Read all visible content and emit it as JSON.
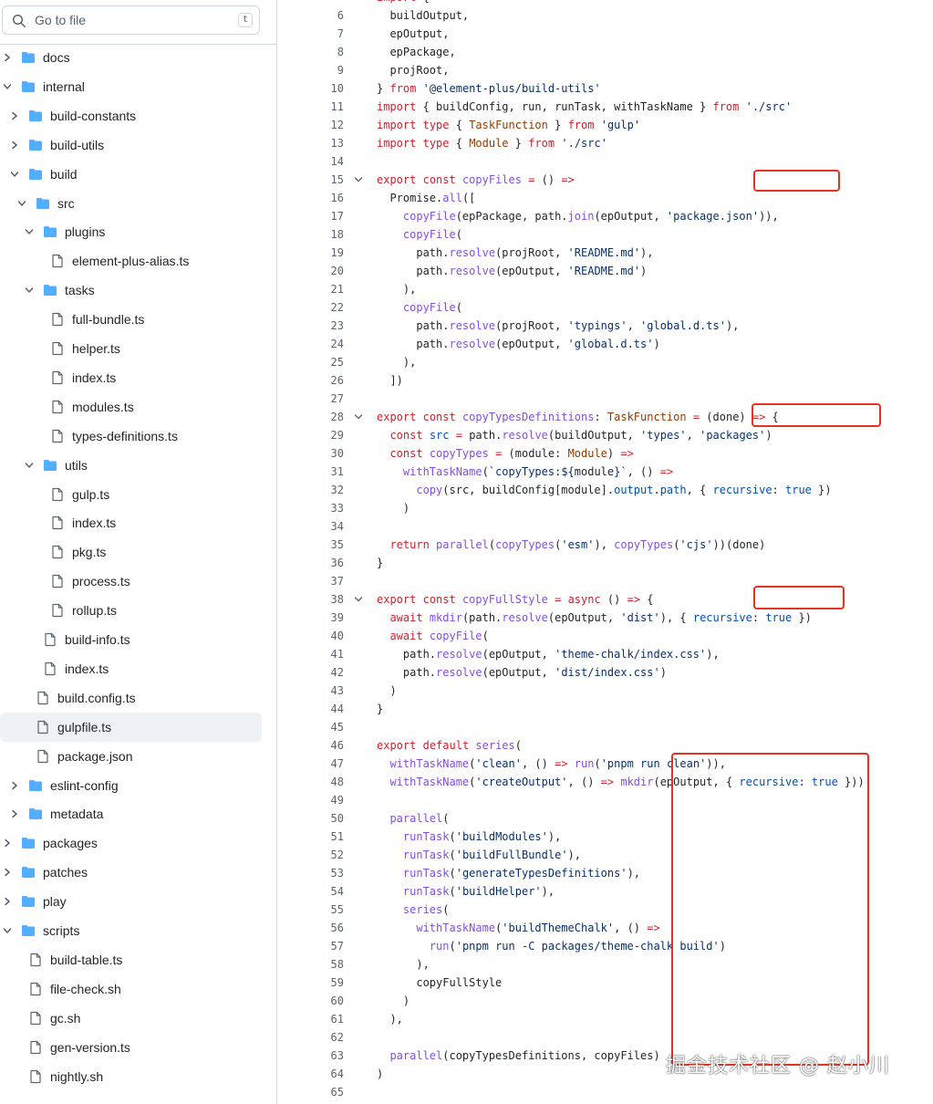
{
  "sidebar": {
    "search": {
      "placeholder": "Go to file",
      "shortcut": "t"
    },
    "tree": [
      {
        "label": "docs",
        "type": "folder",
        "depth": 0,
        "expanded": false
      },
      {
        "label": "internal",
        "type": "folder",
        "depth": 0,
        "expanded": true
      },
      {
        "label": "build-constants",
        "type": "folder",
        "depth": 1,
        "expanded": false
      },
      {
        "label": "build-utils",
        "type": "folder",
        "depth": 1,
        "expanded": false
      },
      {
        "label": "build",
        "type": "folder",
        "depth": 1,
        "expanded": true
      },
      {
        "label": "src",
        "type": "folder",
        "depth": 2,
        "expanded": true
      },
      {
        "label": "plugins",
        "type": "folder",
        "depth": 3,
        "expanded": true
      },
      {
        "label": "element-plus-alias.ts",
        "type": "file",
        "depth": 4
      },
      {
        "label": "tasks",
        "type": "folder",
        "depth": 3,
        "expanded": true
      },
      {
        "label": "full-bundle.ts",
        "type": "file",
        "depth": 4
      },
      {
        "label": "helper.ts",
        "type": "file",
        "depth": 4
      },
      {
        "label": "index.ts",
        "type": "file",
        "depth": 4
      },
      {
        "label": "modules.ts",
        "type": "file",
        "depth": 4
      },
      {
        "label": "types-definitions.ts",
        "type": "file",
        "depth": 4
      },
      {
        "label": "utils",
        "type": "folder",
        "depth": 3,
        "expanded": true
      },
      {
        "label": "gulp.ts",
        "type": "file",
        "depth": 4
      },
      {
        "label": "index.ts",
        "type": "file",
        "depth": 4
      },
      {
        "label": "pkg.ts",
        "type": "file",
        "depth": 4
      },
      {
        "label": "process.ts",
        "type": "file",
        "depth": 4
      },
      {
        "label": "rollup.ts",
        "type": "file",
        "depth": 4
      },
      {
        "label": "build-info.ts",
        "type": "file",
        "depth": 3
      },
      {
        "label": "index.ts",
        "type": "file",
        "depth": 3
      },
      {
        "label": "build.config.ts",
        "type": "file",
        "depth": 2
      },
      {
        "label": "gulpfile.ts",
        "type": "file",
        "depth": 2,
        "selected": true
      },
      {
        "label": "package.json",
        "type": "file",
        "depth": 2
      },
      {
        "label": "eslint-config",
        "type": "folder",
        "depth": 1,
        "expanded": false
      },
      {
        "label": "metadata",
        "type": "folder",
        "depth": 1,
        "expanded": false
      },
      {
        "label": "packages",
        "type": "folder",
        "depth": 0,
        "expanded": false
      },
      {
        "label": "patches",
        "type": "folder",
        "depth": 0,
        "expanded": false
      },
      {
        "label": "play",
        "type": "folder",
        "depth": 0,
        "expanded": false
      },
      {
        "label": "scripts",
        "type": "folder",
        "depth": 0,
        "expanded": true
      },
      {
        "label": "build-table.ts",
        "type": "file",
        "depth": 1
      },
      {
        "label": "file-check.sh",
        "type": "file",
        "depth": 1
      },
      {
        "label": "gc.sh",
        "type": "file",
        "depth": 1
      },
      {
        "label": "gen-version.ts",
        "type": "file",
        "depth": 1
      },
      {
        "label": "nightly.sh",
        "type": "file",
        "depth": 1
      }
    ]
  },
  "code": {
    "lines": [
      {
        "n": "",
        "html": "<span class=\"kw\">import</span> {"
      },
      {
        "n": "6",
        "html": "  buildOutput,"
      },
      {
        "n": "7",
        "html": "  epOutput,"
      },
      {
        "n": "8",
        "html": "  epPackage,"
      },
      {
        "n": "9",
        "html": "  projRoot,"
      },
      {
        "n": "10",
        "html": "} <span class=\"kw\">from</span> <span class=\"str\">'@element-plus/build-utils'</span>"
      },
      {
        "n": "11",
        "html": "<span class=\"kw\">import</span> { buildConfig, run, runTask, withTaskName } <span class=\"kw\">from</span> <span class=\"str\">'./src'</span>"
      },
      {
        "n": "12",
        "html": "<span class=\"kw\">import</span> <span class=\"kw\">type</span> { <span class=\"ty\">TaskFunction</span> } <span class=\"kw\">from</span> <span class=\"str\">'gulp'</span>"
      },
      {
        "n": "13",
        "html": "<span class=\"kw\">import</span> <span class=\"kw\">type</span> { <span class=\"ty\">Module</span> } <span class=\"kw\">from</span> <span class=\"str\">'./src'</span>"
      },
      {
        "n": "14",
        "html": ""
      },
      {
        "n": "15",
        "html": "<span class=\"kw\">export</span> <span class=\"kw\">const</span> <span class=\"fn\">copyFiles</span> <span class=\"kw\">=</span> () <span class=\"kw\">=&gt;</span>",
        "fold": true
      },
      {
        "n": "16",
        "html": "  Promise.<span class=\"fn\">all</span>(["
      },
      {
        "n": "17",
        "html": "    <span class=\"fn\">copyFile</span>(epPackage, path.<span class=\"fn\">join</span>(epOutput, <span class=\"str\">'package.json'</span>)),"
      },
      {
        "n": "18",
        "html": "    <span class=\"fn\">copyFile</span>("
      },
      {
        "n": "19",
        "html": "      path.<span class=\"fn\">resolve</span>(projRoot, <span class=\"str\">'README.md'</span>),"
      },
      {
        "n": "20",
        "html": "      path.<span class=\"fn\">resolve</span>(epOutput, <span class=\"str\">'README.md'</span>)"
      },
      {
        "n": "21",
        "html": "    ),"
      },
      {
        "n": "22",
        "html": "    <span class=\"fn\">copyFile</span>("
      },
      {
        "n": "23",
        "html": "      path.<span class=\"fn\">resolve</span>(projRoot, <span class=\"str\">'typings'</span>, <span class=\"str\">'global.d.ts'</span>),"
      },
      {
        "n": "24",
        "html": "      path.<span class=\"fn\">resolve</span>(epOutput, <span class=\"str\">'global.d.ts'</span>)"
      },
      {
        "n": "25",
        "html": "    ),"
      },
      {
        "n": "26",
        "html": "  ])"
      },
      {
        "n": "27",
        "html": ""
      },
      {
        "n": "28",
        "html": "<span class=\"kw\">export</span> <span class=\"kw\">const</span> <span class=\"fn\">copyTypesDefinitions</span>: <span class=\"ty\">TaskFunction</span> <span class=\"kw\">=</span> (done) <span class=\"kw\">=&gt;</span> {",
        "fold": true
      },
      {
        "n": "29",
        "html": "  <span class=\"kw\">const</span> <span class=\"con\">src</span> <span class=\"kw\">=</span> path.<span class=\"fn\">resolve</span>(buildOutput, <span class=\"str\">'types'</span>, <span class=\"str\">'packages'</span>)"
      },
      {
        "n": "30",
        "html": "  <span class=\"kw\">const</span> <span class=\"fn\">copyTypes</span> <span class=\"kw\">=</span> (module: <span class=\"ty\">Module</span>) <span class=\"kw\">=&gt;</span>"
      },
      {
        "n": "31",
        "html": "    <span class=\"fn\">withTaskName</span>(<span class=\"str\">`copyTypes:${</span>module<span class=\"str\">}`</span>, () <span class=\"kw\">=&gt;</span>"
      },
      {
        "n": "32",
        "html": "      <span class=\"fn\">copy</span>(src, buildConfig[module].<span class=\"con\">output</span>.<span class=\"con\">path</span>, { <span class=\"con\">recursive</span>: <span class=\"con\">true</span> })"
      },
      {
        "n": "33",
        "html": "    )"
      },
      {
        "n": "34",
        "html": ""
      },
      {
        "n": "35",
        "html": "  <span class=\"kw\">return</span> <span class=\"fn\">parallel</span>(<span class=\"fn\">copyTypes</span>(<span class=\"str\">'esm'</span>), <span class=\"fn\">copyTypes</span>(<span class=\"str\">'cjs'</span>))(done)"
      },
      {
        "n": "36",
        "html": "}"
      },
      {
        "n": "37",
        "html": ""
      },
      {
        "n": "38",
        "html": "<span class=\"kw\">export</span> <span class=\"kw\">const</span> <span class=\"fn\">copyFullStyle</span> <span class=\"kw\">=</span> <span class=\"kw\">async</span> () <span class=\"kw\">=&gt;</span> {",
        "fold": true
      },
      {
        "n": "39",
        "html": "  <span class=\"kw\">await</span> <span class=\"fn\">mkdir</span>(path.<span class=\"fn\">resolve</span>(epOutput, <span class=\"str\">'dist'</span>), { <span class=\"con\">recursive</span>: <span class=\"con\">true</span> })"
      },
      {
        "n": "40",
        "html": "  <span class=\"kw\">await</span> <span class=\"fn\">copyFile</span>("
      },
      {
        "n": "41",
        "html": "    path.<span class=\"fn\">resolve</span>(epOutput, <span class=\"str\">'theme-chalk/index.css'</span>),"
      },
      {
        "n": "42",
        "html": "    path.<span class=\"fn\">resolve</span>(epOutput, <span class=\"str\">'dist/index.css'</span>)"
      },
      {
        "n": "43",
        "html": "  )"
      },
      {
        "n": "44",
        "html": "}"
      },
      {
        "n": "45",
        "html": ""
      },
      {
        "n": "46",
        "html": "<span class=\"kw\">export</span> <span class=\"kw\">default</span> <span class=\"fn\">series</span>("
      },
      {
        "n": "47",
        "html": "  <span class=\"fn\">withTaskName</span>(<span class=\"str\">'clean'</span>, () <span class=\"kw\">=&gt;</span> <span class=\"fn\">run</span>(<span class=\"str\">'pnpm run clean'</span>)),"
      },
      {
        "n": "48",
        "html": "  <span class=\"fn\">withTaskName</span>(<span class=\"str\">'createOutput'</span>, () <span class=\"kw\">=&gt;</span> <span class=\"fn\">mkdir</span>(epOutput, { <span class=\"con\">recursive</span>: <span class=\"con\">true</span> }))"
      },
      {
        "n": "49",
        "html": ""
      },
      {
        "n": "50",
        "html": "  <span class=\"fn\">parallel</span>("
      },
      {
        "n": "51",
        "html": "    <span class=\"fn\">runTask</span>(<span class=\"str\">'buildModules'</span>),"
      },
      {
        "n": "52",
        "html": "    <span class=\"fn\">runTask</span>(<span class=\"str\">'buildFullBundle'</span>),"
      },
      {
        "n": "53",
        "html": "    <span class=\"fn\">runTask</span>(<span class=\"str\">'generateTypesDefinitions'</span>),"
      },
      {
        "n": "54",
        "html": "    <span class=\"fn\">runTask</span>(<span class=\"str\">'buildHelper'</span>),"
      },
      {
        "n": "55",
        "html": "    <span class=\"fn\">series</span>("
      },
      {
        "n": "56",
        "html": "      <span class=\"fn\">withTaskName</span>(<span class=\"str\">'buildThemeChalk'</span>, () <span class=\"kw\">=&gt;</span>"
      },
      {
        "n": "57",
        "html": "        <span class=\"fn\">run</span>(<span class=\"str\">'pnpm run -C packages/theme-chalk build'</span>)"
      },
      {
        "n": "58",
        "html": "      ),"
      },
      {
        "n": "59",
        "html": "      copyFullStyle"
      },
      {
        "n": "60",
        "html": "    )"
      },
      {
        "n": "61",
        "html": "  ),"
      },
      {
        "n": "62",
        "html": ""
      },
      {
        "n": "63",
        "html": "  <span class=\"fn\">parallel</span>(copyTypesDefinitions, copyFiles)"
      },
      {
        "n": "64",
        "html": ")"
      },
      {
        "n": "65",
        "html": ""
      }
    ]
  },
  "watermark": "掘金技术社区 @ 赵小川",
  "colors": {
    "folder": "#54aeff",
    "highlight_box": "#e8321f",
    "keyword": "#cf222e",
    "function": "#8250df",
    "string": "#0a3069",
    "constant": "#0550ae"
  }
}
